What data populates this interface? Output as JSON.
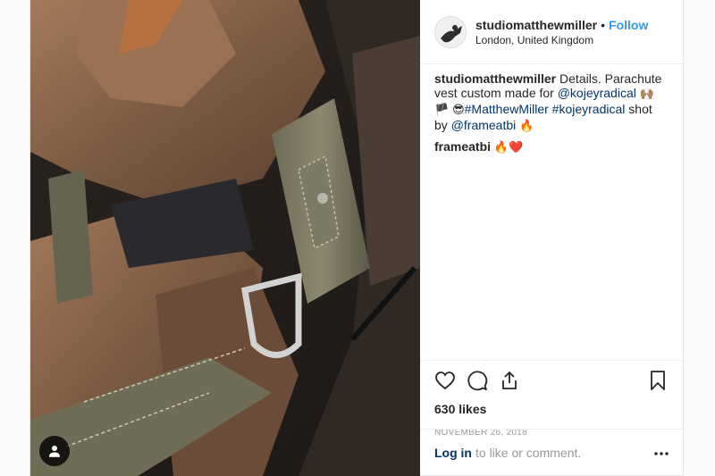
{
  "post": {
    "username": "studiomatthewmiller",
    "separator": "•",
    "follow_label": "Follow",
    "location": "London, United Kingdom",
    "caption": {
      "username": "studiomatthewmiller",
      "text_1": "Details. Parachute vest custom made for ",
      "mention_1": "@kojeyradical",
      "emoji_1": "🙌🏽🏴",
      "emoji_2": "😎",
      "hashtag_1": "#MatthewMiller",
      "hashtag_2": "#kojeyradical",
      "text_2": " shot by ",
      "mention_2": "@frameatbi",
      "emoji_3": "🔥"
    },
    "comment": {
      "username": "frameatbi",
      "emoji": "🔥❤️"
    },
    "likes": "630 likes",
    "date": "NOVEMBER 26, 2018",
    "login": {
      "link": "Log in",
      "text": "to like or comment."
    },
    "icons": {
      "like": "heart-icon",
      "comment": "comment-icon",
      "share": "share-icon",
      "save": "bookmark-icon",
      "more": "more-dots-icon",
      "user_tag": "user-tag-icon"
    }
  },
  "colors": {
    "accent": "#3897f0",
    "link": "#003569",
    "muted": "#999999",
    "text": "#262626"
  }
}
